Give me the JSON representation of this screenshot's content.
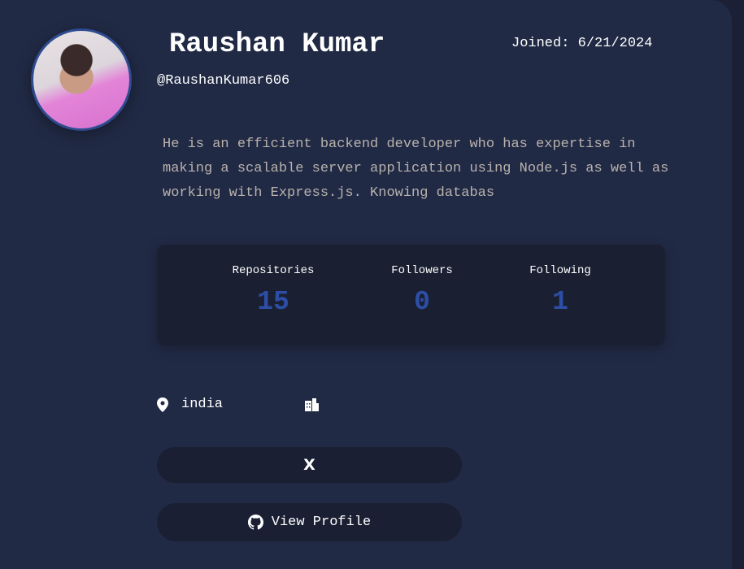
{
  "profile": {
    "name": "Raushan Kumar",
    "joined": "Joined: 6/21/2024",
    "handle": "@RaushanKumar606",
    "bio": "He is an efficient backend developer who has expertise in making a scalable server application using Node.js as well as working with Express.js. Knowing databas",
    "location": "india"
  },
  "stats": [
    {
      "label": "Repositories",
      "value": "15"
    },
    {
      "label": "Followers",
      "value": "0"
    },
    {
      "label": "Following",
      "value": "1"
    }
  ],
  "buttons": {
    "twitter_label": "X",
    "github_label": "View Profile"
  },
  "colors": {
    "card": "#212a45",
    "panel": "#1a2032",
    "accent": "#2d4ea6"
  }
}
